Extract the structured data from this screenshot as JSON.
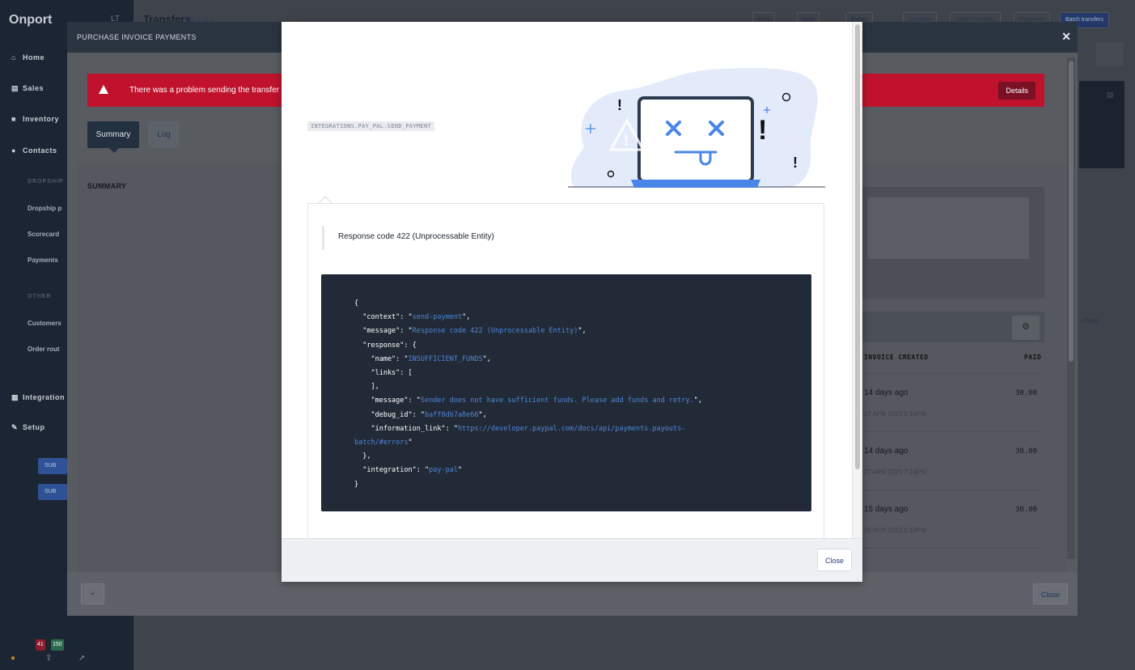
{
  "app": {
    "logo": "Onport",
    "top_icon": "LT",
    "nav": [
      {
        "label": "Home",
        "icon": "home-icon"
      },
      {
        "label": "Sales",
        "icon": "cart-icon"
      },
      {
        "label": "Inventory",
        "icon": "bookmark-icon"
      },
      {
        "label": "Contacts",
        "icon": "user-icon"
      }
    ],
    "sections": [
      "DROPSHIP",
      "OTHER"
    ],
    "sub_items": [
      "Dropship p",
      "Scorecard",
      "Payments",
      "Customers",
      "Order rout"
    ],
    "nav2": [
      {
        "label": "Integration",
        "icon": "grid-icon"
      },
      {
        "label": "Setup",
        "icon": "wrench-icon"
      }
    ],
    "sidebar_buttons": [
      "SUB",
      "SUB"
    ],
    "badges": [
      "41",
      "150"
    ]
  },
  "page": {
    "title": "Transfers",
    "count": "1 to 1 of 1",
    "buttons": [
      "Prev",
      "Next",
      "Export",
      "Scorecre",
      "Search invoices",
      "Payments",
      "Batch transfers"
    ],
    "next_label": "Next"
  },
  "invoice_modal": {
    "title": "PURCHASE INVOICE PAYMENTS",
    "alert_text": "There was a problem sending the transfer",
    "alert_button": "Details",
    "tabs": [
      "Summary",
      "Log"
    ],
    "summary_label": "SUMMARY",
    "columns": [
      "INVOICE CREATED",
      "PAID"
    ],
    "rows": [
      {
        "created": "14 days ago",
        "date": "27 APR 2023 6:16PM",
        "paid": "30.00"
      },
      {
        "created": "14 days ago",
        "date": "27 APR 2023 7:18PM",
        "paid": "30.00"
      },
      {
        "created": "15 days ago",
        "date": "26 APR 2023 5:18PM",
        "paid": "30.00"
      }
    ],
    "close_label": "Close"
  },
  "error_modal": {
    "code_tag": "INTEGRATIONS.PAY_PAL.SEND_PAYMENT",
    "message": "Response code 422 (Unprocessable Entity)",
    "json": {
      "context": "send-payment",
      "message": "Response code 422 (Unprocessable Entity)",
      "response_name": "INSUFFICIENT_FUNDS",
      "response_message": "Sender does not have sufficient funds. Please add funds and retry.",
      "debug_id": "baff8db7a8e66",
      "information_link_part1": "https://developer.paypal.com/docs/api/payments.payouts-",
      "information_link_part2": "batch/#errors",
      "integration": "pay-pal"
    },
    "close_label": "Close"
  }
}
